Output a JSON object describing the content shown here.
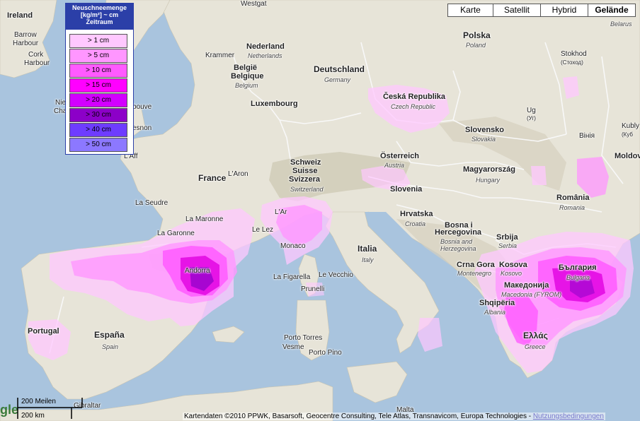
{
  "legend": {
    "title": "Neuschneemenge [kg/m²] ~ cm Zeitraum",
    "items": [
      {
        "label": "> 1 cm",
        "color": "#ffc8ff"
      },
      {
        "label": "> 5 cm",
        "color": "#ff96ff"
      },
      {
        "label": "> 10 cm",
        "color": "#ff5aff"
      },
      {
        "label": "> 15 cm",
        "color": "#ff00ff"
      },
      {
        "label": "> 20 cm",
        "color": "#d200ff"
      },
      {
        "label": "> 30 cm",
        "color": "#8c00c8"
      },
      {
        "label": "> 40 cm",
        "color": "#6e3cff"
      },
      {
        "label": "> 50 cm",
        "color": "#8c78ff"
      }
    ]
  },
  "map_types": {
    "karte": "Karte",
    "satellit": "Satellit",
    "hybrid": "Hybrid",
    "gelaende": "Gelände",
    "active": "Gelände"
  },
  "labels": {
    "westgat": "Westgat",
    "ireland": "Ireland",
    "barrow": "Barrow",
    "harbour1": "Harbour",
    "cork": "Cork",
    "harbour2": "Harbour",
    "nederland": "Nederland",
    "netherlands": "Netherlands",
    "krammer": "Krammer",
    "belgie": "België",
    "belgique": "Belgique",
    "belgium": "Belgium",
    "luxembourg": "Luxembourg",
    "deutschland": "Deutschland",
    "germany": "Germany",
    "polska": "Polska",
    "poland": "Poland",
    "belarus": "Belarus",
    "ceska": "Česká Republika",
    "czech": "Czech Republic",
    "stokhod": "Stokhod",
    "stokhod_cyr": "(Стоход)",
    "slovensko": "Slovensko",
    "slovakia": "Slovakia",
    "ug": "Ug",
    "uh": "(Уг)",
    "viniya": "Вінія",
    "kubly": "Kubly",
    "kuby": "(Куб",
    "moldov": "Moldov",
    "nie": "Nie",
    "cha": "Cha",
    "bouve": "bouve",
    "esnon": "esnon",
    "laff": "L'Aff",
    "schweiz": "Schweiz",
    "suisse": "Suisse",
    "svizzera": "Svizzera",
    "switzerland": "Switzerland",
    "osterreich": "Österreich",
    "austria": "Austria",
    "magyarorszag": "Magyarország",
    "hungary": "Hungary",
    "france": "France",
    "laron": "L'Aron",
    "romania": "România",
    "romania_en": "Romania",
    "slovenia": "Slovenia",
    "laseudre": "La Seudre",
    "lamaronne": "La Maronne",
    "lagaronne": "La Garonne",
    "lelez": "Le Lez",
    "lar": "L'Ar",
    "monaco": "Monaco",
    "hrvatska": "Hrvatska",
    "croatia": "Croatia",
    "bosna": "Bosna i",
    "hercegovina": "Hercegovina",
    "bosnia": "Bosnia and",
    "herzegovina": "Herzegovina",
    "srbija": "Srbija",
    "serbia": "Serbia",
    "italia": "Italia",
    "italy": "Italy",
    "andorra": "Andorra",
    "lafigarella": "La Figarella",
    "levecchio": "Le Vecchio",
    "prunelli": "Prunelli",
    "crnagora": "Crna Gora",
    "montenegro": "Montenegro",
    "kosova": "Kosova",
    "kosovo": "Kosovo",
    "bulgaria_cyr": "България",
    "bulgaria": "Bulgaria",
    "makedonija": "Македонија",
    "macedonia": "Macedonia (FYROM)",
    "shqiperia": "Shqipëria",
    "albania": "Albania",
    "ellas": "Ελλάς",
    "greece": "Greece",
    "portugal": "Portugal",
    "espana": "España",
    "spain": "Spain",
    "portotorres": "Porto Torres",
    "vesme": "Vesme",
    "portopino": "Porto Pino",
    "malta": "Malta",
    "gibraltar": "Gibraltar"
  },
  "scale": {
    "miles": "200 Meilen",
    "km": "200 km"
  },
  "attribution": {
    "text": "Kartendaten ©2010 PPWK, Basarsoft, Geocentre Consulting, Tele Atlas, Transnavicom, Europa Technologies - ",
    "link": "Nutzungsbedingungen"
  },
  "google_logo": "gle"
}
